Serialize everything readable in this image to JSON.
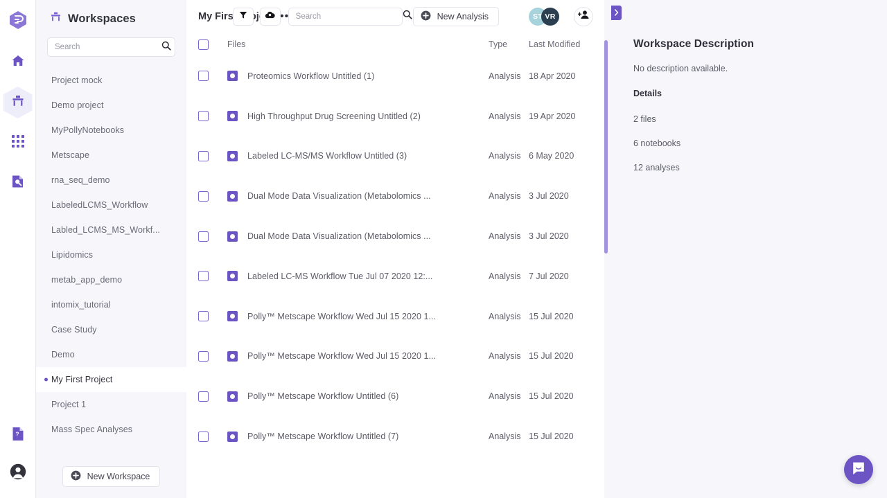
{
  "brand": {
    "accent": "#6c54c4",
    "accent_light": "#a393de",
    "panel_bg": "#f6f6fb"
  },
  "rail": {
    "logo": "polly-logo-icon",
    "items": [
      {
        "icon": "home-icon",
        "name": "rail-item-home",
        "active": false
      },
      {
        "icon": "workspace-desk-icon",
        "name": "rail-item-workspaces",
        "active": true
      },
      {
        "icon": "grid-apps-icon",
        "name": "rail-item-apps",
        "active": false
      },
      {
        "icon": "document-search-icon",
        "name": "rail-item-explore",
        "active": false
      }
    ],
    "bottom": [
      {
        "icon": "help-document-icon",
        "name": "rail-item-help"
      },
      {
        "icon": "user-avatar-icon",
        "name": "rail-item-account"
      }
    ]
  },
  "sidebar": {
    "title": "Workspaces",
    "title_icon": "workspace-desk-icon",
    "search_placeholder": "Search",
    "search_value": "",
    "search_icon": "search-icon",
    "collapse_icon": "chevron-left-icon",
    "new_workspace_label": "New Workspace",
    "items": [
      {
        "label": "Project mock",
        "selected": false
      },
      {
        "label": "Demo project",
        "selected": false
      },
      {
        "label": "MyPollyNotebooks",
        "selected": false
      },
      {
        "label": "Metscape",
        "selected": false
      },
      {
        "label": "rna_seq_demo",
        "selected": false
      },
      {
        "label": "LabeledLCMS_Workflow",
        "selected": false
      },
      {
        "label": "Labled_LCMS_MS_Workf...",
        "selected": false
      },
      {
        "label": "Lipidomics",
        "selected": false
      },
      {
        "label": "metab_app_demo",
        "selected": false
      },
      {
        "label": "intomix_tutorial",
        "selected": false
      },
      {
        "label": "Case Study",
        "selected": false
      },
      {
        "label": "Demo",
        "selected": false
      },
      {
        "label": "My First Project",
        "selected": true
      },
      {
        "label": "Project 1",
        "selected": false
      },
      {
        "label": "Mass Spec Analyses",
        "selected": false
      }
    ]
  },
  "topbar": {
    "project_title": "My First Proje...",
    "more_menu": "•••",
    "filter_icon": "filter-funnel-icon",
    "upload_icon": "cloud-upload-icon",
    "search_placeholder": "Search",
    "search_value": "",
    "new_analysis_label": "New Analysis",
    "add_person_icon": "add-person-icon",
    "avatars": [
      {
        "initials": "ST",
        "color": "#a7d3dc",
        "text_color": "#ffffff"
      },
      {
        "initials": "VR",
        "color": "#2b3f51",
        "text_color": "#ffffff"
      }
    ]
  },
  "table": {
    "headers": {
      "files": "Files",
      "type": "Type",
      "modified": "Last Modified"
    },
    "rows": [
      {
        "name": "Proteomics Workflow Untitled (1)",
        "type": "Analysis",
        "modified": "18 Apr 2020"
      },
      {
        "name": "High Throughput Drug Screening Untitled (2)",
        "type": "Analysis",
        "modified": "19 Apr 2020"
      },
      {
        "name": "Labeled LC-MS/MS Workflow Untitled (3)",
        "type": "Analysis",
        "modified": "6 May 2020"
      },
      {
        "name": "Dual Mode Data Visualization (Metabolomics ...",
        "type": "Analysis",
        "modified": "3 Jul 2020"
      },
      {
        "name": "Dual Mode Data Visualization (Metabolomics ...",
        "type": "Analysis",
        "modified": "3 Jul 2020"
      },
      {
        "name": "Labeled LC-MS Workflow Tue Jul 07 2020 12:...",
        "type": "Analysis",
        "modified": "7 Jul 2020"
      },
      {
        "name": "Polly™ Metscape Workflow Wed Jul 15 2020 1...",
        "type": "Analysis",
        "modified": "15 Jul 2020"
      },
      {
        "name": "Polly™ Metscape Workflow Wed Jul 15 2020 1...",
        "type": "Analysis",
        "modified": "15 Jul 2020"
      },
      {
        "name": "Polly™ Metscape Workflow Untitled (6)",
        "type": "Analysis",
        "modified": "15 Jul 2020"
      },
      {
        "name": "Polly™ Metscape Workflow Untitled (7)",
        "type": "Analysis",
        "modified": "15 Jul 2020"
      }
    ]
  },
  "right_panel": {
    "collapse_icon": "chevron-right-icon",
    "title": "Workspace Description",
    "description": "No description available.",
    "details_label": "Details",
    "details": [
      "2 files",
      "6 notebooks",
      "12 analyses"
    ]
  },
  "intercom": {
    "icon": "chat-bubble-icon"
  }
}
